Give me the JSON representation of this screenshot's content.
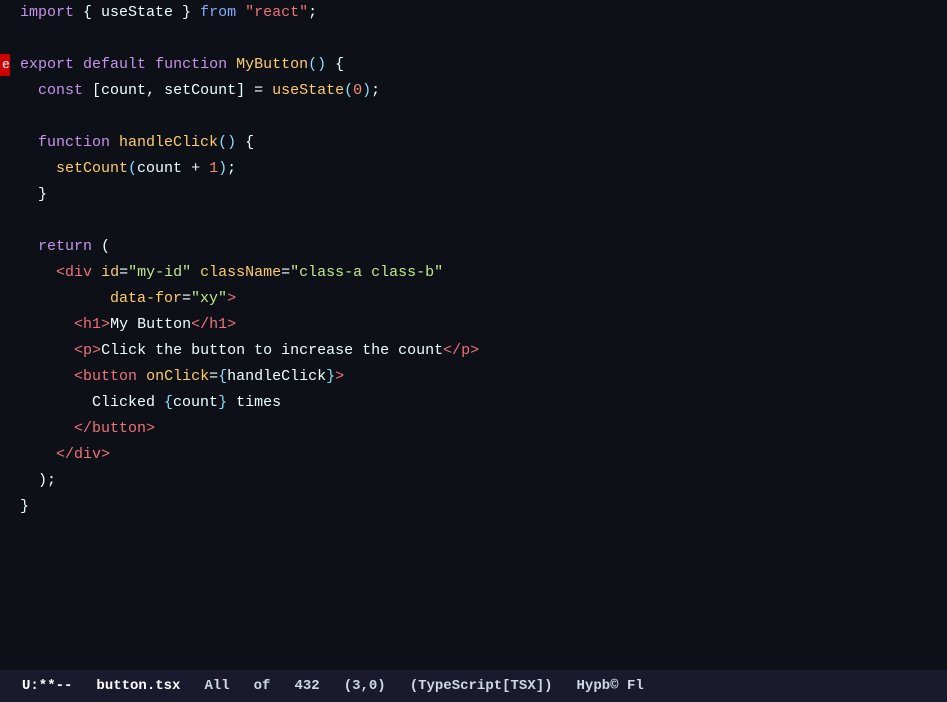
{
  "editor": {
    "background": "#0d1117",
    "lines": [
      {
        "id": "line1",
        "tokens": [
          {
            "text": "import",
            "class": "kw-purple"
          },
          {
            "text": " { ",
            "class": "plain"
          },
          {
            "text": "useState",
            "class": "var-name"
          },
          {
            "text": " } ",
            "class": "plain"
          },
          {
            "text": "from",
            "class": "kw-blue"
          },
          {
            "text": " ",
            "class": "plain"
          },
          {
            "text": "\"react\"",
            "class": "str-red"
          },
          {
            "text": ";",
            "class": "plain"
          }
        ]
      },
      {
        "id": "line-empty1",
        "tokens": []
      },
      {
        "id": "line2",
        "hasErrorMarker": true,
        "tokens": [
          {
            "text": "export",
            "class": "kw-purple"
          },
          {
            "text": " ",
            "class": "plain"
          },
          {
            "text": "default",
            "class": "kw-purple"
          },
          {
            "text": " ",
            "class": "plain"
          },
          {
            "text": "function",
            "class": "kw-purple"
          },
          {
            "text": " ",
            "class": "plain"
          },
          {
            "text": "MyButton",
            "class": "fn-yellow"
          },
          {
            "text": "(",
            "class": "bracket"
          },
          {
            "text": ")",
            "class": "bracket"
          },
          {
            "text": " {",
            "class": "plain"
          }
        ]
      },
      {
        "id": "line3",
        "indent": "  ",
        "tokens": [
          {
            "text": "  ",
            "class": "plain"
          },
          {
            "text": "const",
            "class": "kw-purple"
          },
          {
            "text": " [",
            "class": "plain"
          },
          {
            "text": "count",
            "class": "var-name"
          },
          {
            "text": ", ",
            "class": "plain"
          },
          {
            "text": "setCount",
            "class": "var-name"
          },
          {
            "text": "] = ",
            "class": "plain"
          },
          {
            "text": "useState",
            "class": "fn-yellow"
          },
          {
            "text": "(",
            "class": "bracket"
          },
          {
            "text": "0",
            "class": "num"
          },
          {
            "text": ");",
            "class": "plain"
          }
        ]
      },
      {
        "id": "line-empty2",
        "tokens": []
      },
      {
        "id": "line4",
        "tokens": [
          {
            "text": "  ",
            "class": "plain"
          },
          {
            "text": "function",
            "class": "kw-purple"
          },
          {
            "text": " ",
            "class": "plain"
          },
          {
            "text": "handleClick",
            "class": "fn-yellow"
          },
          {
            "text": "(",
            "class": "bracket"
          },
          {
            "text": ")",
            "class": "bracket"
          },
          {
            "text": " {",
            "class": "plain"
          }
        ]
      },
      {
        "id": "line5",
        "tokens": [
          {
            "text": "    ",
            "class": "plain"
          },
          {
            "text": "setCount",
            "class": "fn-yellow"
          },
          {
            "text": "(",
            "class": "bracket"
          },
          {
            "text": "count",
            "class": "var-name"
          },
          {
            "text": " + ",
            "class": "plain"
          },
          {
            "text": "1",
            "class": "num"
          },
          {
            "text": ");",
            "class": "plain"
          }
        ]
      },
      {
        "id": "line6",
        "tokens": [
          {
            "text": "  }",
            "class": "plain"
          }
        ]
      },
      {
        "id": "line-empty3",
        "tokens": []
      },
      {
        "id": "line7",
        "tokens": [
          {
            "text": "  ",
            "class": "plain"
          },
          {
            "text": "return",
            "class": "kw-purple"
          },
          {
            "text": " (",
            "class": "plain"
          }
        ]
      },
      {
        "id": "line8",
        "tokens": [
          {
            "text": "    ",
            "class": "plain"
          },
          {
            "text": "<",
            "class": "tag"
          },
          {
            "text": "div",
            "class": "tag"
          },
          {
            "text": " ",
            "class": "plain"
          },
          {
            "text": "id",
            "class": "attr-name"
          },
          {
            "text": "=",
            "class": "plain"
          },
          {
            "text": "\"my-id\"",
            "class": "attr-value"
          },
          {
            "text": " ",
            "class": "plain"
          },
          {
            "text": "className",
            "class": "attr-name"
          },
          {
            "text": "=",
            "class": "plain"
          },
          {
            "text": "\"class-a class-b\"",
            "class": "attr-value"
          }
        ]
      },
      {
        "id": "line9",
        "tokens": [
          {
            "text": "          ",
            "class": "plain"
          },
          {
            "text": "data-for",
            "class": "attr-name"
          },
          {
            "text": "=",
            "class": "plain"
          },
          {
            "text": "\"xy\"",
            "class": "attr-value"
          },
          {
            "text": ">",
            "class": "tag"
          }
        ]
      },
      {
        "id": "line10",
        "tokens": [
          {
            "text": "      ",
            "class": "plain"
          },
          {
            "text": "<",
            "class": "tag"
          },
          {
            "text": "h1",
            "class": "tag"
          },
          {
            "text": ">",
            "class": "tag"
          },
          {
            "text": "My Button",
            "class": "plain"
          },
          {
            "text": "</",
            "class": "tag"
          },
          {
            "text": "h1",
            "class": "tag"
          },
          {
            "text": ">",
            "class": "tag"
          }
        ]
      },
      {
        "id": "line11",
        "tokens": [
          {
            "text": "      ",
            "class": "plain"
          },
          {
            "text": "<",
            "class": "tag"
          },
          {
            "text": "p",
            "class": "tag"
          },
          {
            "text": ">",
            "class": "tag"
          },
          {
            "text": "Click the button to increase the count",
            "class": "plain"
          },
          {
            "text": "</",
            "class": "tag"
          },
          {
            "text": "p",
            "class": "tag"
          },
          {
            "text": ">",
            "class": "tag"
          }
        ]
      },
      {
        "id": "line12",
        "tokens": [
          {
            "text": "      ",
            "class": "plain"
          },
          {
            "text": "<",
            "class": "tag"
          },
          {
            "text": "button",
            "class": "tag"
          },
          {
            "text": " ",
            "class": "plain"
          },
          {
            "text": "onClick",
            "class": "attr-name"
          },
          {
            "text": "=",
            "class": "plain"
          },
          {
            "text": "{",
            "class": "expr"
          },
          {
            "text": "handleClick",
            "class": "var-name"
          },
          {
            "text": "}",
            "class": "expr"
          },
          {
            "text": ">",
            "class": "tag"
          }
        ]
      },
      {
        "id": "line13",
        "tokens": [
          {
            "text": "        ",
            "class": "plain"
          },
          {
            "text": "Clicked ",
            "class": "plain"
          },
          {
            "text": "{",
            "class": "expr"
          },
          {
            "text": "count",
            "class": "var-name"
          },
          {
            "text": "}",
            "class": "expr"
          },
          {
            "text": " times",
            "class": "plain"
          }
        ]
      },
      {
        "id": "line14",
        "tokens": [
          {
            "text": "      ",
            "class": "plain"
          },
          {
            "text": "</",
            "class": "tag"
          },
          {
            "text": "button",
            "class": "tag"
          },
          {
            "text": ">",
            "class": "tag"
          }
        ]
      },
      {
        "id": "line15",
        "tokens": [
          {
            "text": "    ",
            "class": "plain"
          },
          {
            "text": "</",
            "class": "tag"
          },
          {
            "text": "div",
            "class": "tag"
          },
          {
            "text": ">",
            "class": "tag"
          }
        ]
      },
      {
        "id": "line16",
        "tokens": [
          {
            "text": "  );",
            "class": "plain"
          }
        ]
      },
      {
        "id": "line17",
        "tokens": [
          {
            "text": "}",
            "class": "plain"
          }
        ]
      }
    ]
  },
  "statusbar": {
    "mode": "U:**--",
    "filename": "button.tsx",
    "position_label": "All",
    "position_of": "of",
    "total_lines": "432",
    "cursor": "(3,0)",
    "filetype": "(TypeScript[TSX])",
    "extra": "Hypb© Fl"
  }
}
